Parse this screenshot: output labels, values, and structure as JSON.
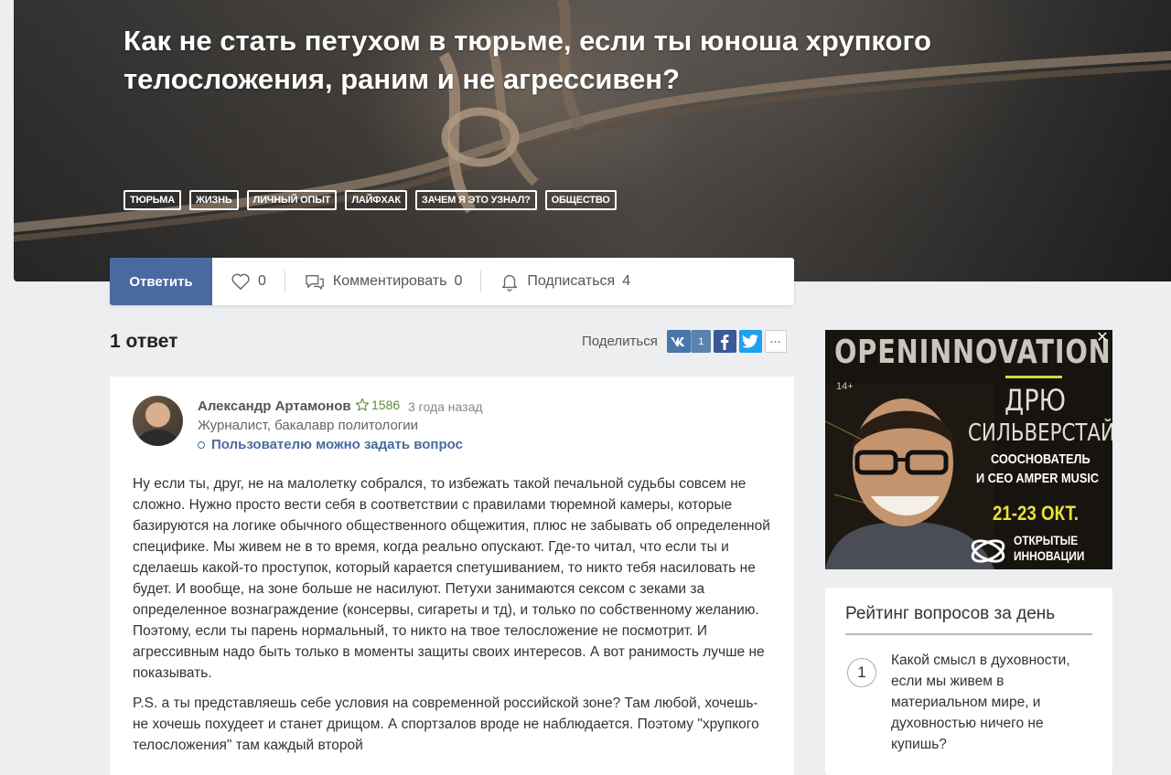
{
  "question": {
    "title": "Как не стать петухом в тюрьме, если ты юноша хрупкого телосложения, раним и не агрессивен?",
    "tags": [
      "тюрьма",
      "жизнь",
      "личный опыт",
      "лайфхак",
      "зачем я это узнал?",
      "общество"
    ]
  },
  "actions": {
    "answer_label": "Ответить",
    "likes": "0",
    "comment_label": "Комментировать",
    "comments": "0",
    "subscribe_label": "Подписаться",
    "subscribers": "4"
  },
  "answers_header": "1 ответ",
  "share": {
    "label": "Поделиться",
    "vk_count": "1",
    "more": "···"
  },
  "answer": {
    "author_name": "Александр Артамонов",
    "author_rating": "1586",
    "time": "3 года назад",
    "author_desc": "Журналист, бакалавр политологии",
    "ask_label": "Пользователю можно задать вопрос",
    "paragraphs": [
      "Ну если ты, друг, не на малолетку собрался, то избежать такой печальной судьбы совсем не сложно. Нужно просто вести себя в соответствии с правилами тюремной камеры, которые базируются на логике обычного общественного общежития, плюс не забывать об определенной специфике. Мы живем не в то время, когда реально опускают. Где-то читал, что если ты и сделаешь какой-то проступок, который карается спетушиванием, то никто тебя насиловать не будет. И вообще, на зоне больше не насилуют. Петухи занимаются сексом с зеками за определенное вознаграждение (консервы, сигареты и тд), и только по собственному желанию. Поэтому, если ты парень нормальный, то никто на твое телосложение не посмотрит. И агрессивным надо быть только в моменты защиты своих интересов. А вот ранимость лучше не показывать.",
      "P.S. а ты представляешь себе условия на современной российской зоне? Там любой, хочешь-не хочешь похудеет и станет дрищом. А спортзалов вроде не наблюдается. Поэтому \"хрупкого телосложения\" там каждый второй"
    ]
  },
  "ad": {
    "brand": "OPENINNOVATIONS",
    "age": "14+",
    "name_first": "ДРЮ",
    "name_last": "СИЛЬВЕРСТАЙН",
    "role_line1": "СООСНОВАТЕЛЬ",
    "role_line2": "И CEO AMPER MUSIC",
    "dates": "21-23 ОКТ.",
    "logo_line1": "ОТКРЫТЫЕ",
    "logo_line2": "ИННОВАЦИИ",
    "close": "✕",
    "accent_color": "#e5e23a"
  },
  "daily_rating": {
    "title": "Рейтинг вопросов за день",
    "items": [
      {
        "rank": "1",
        "question": "Какой смысл в духовности, если мы живем в материальном мире, и духовностью ничего не купишь?"
      }
    ]
  },
  "colors": {
    "primary": "#4a6a9f",
    "vk": "#4a76a8",
    "facebook": "#3b5998",
    "twitter": "#1da1f2",
    "rating_green": "#5b8a3a"
  }
}
